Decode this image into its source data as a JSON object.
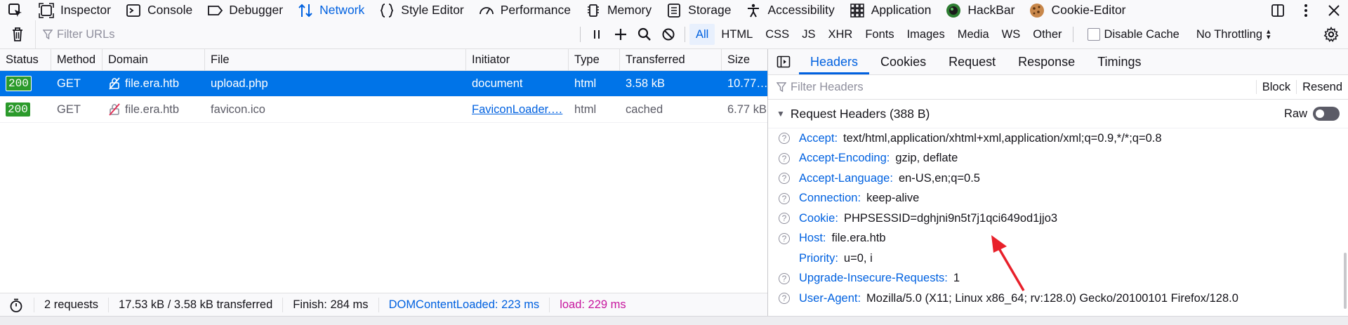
{
  "toolbox": {
    "tabs": [
      {
        "label": "Inspector",
        "icon": "inspector-icon"
      },
      {
        "label": "Console",
        "icon": "console-icon"
      },
      {
        "label": "Debugger",
        "icon": "debugger-icon"
      },
      {
        "label": "Network",
        "icon": "network-icon",
        "selected": true
      },
      {
        "label": "Style Editor",
        "icon": "style-editor-icon"
      },
      {
        "label": "Performance",
        "icon": "performance-icon"
      },
      {
        "label": "Memory",
        "icon": "memory-icon"
      },
      {
        "label": "Storage",
        "icon": "storage-icon"
      },
      {
        "label": "Accessibility",
        "icon": "accessibility-icon"
      },
      {
        "label": "Application",
        "icon": "application-icon"
      },
      {
        "label": "HackBar",
        "icon": "hackbar-icon"
      },
      {
        "label": "Cookie-Editor",
        "icon": "cookie-icon"
      }
    ]
  },
  "network_toolbar": {
    "filter_placeholder": "Filter URLs",
    "type_filters": [
      "All",
      "HTML",
      "CSS",
      "JS",
      "XHR",
      "Fonts",
      "Images",
      "Media",
      "WS",
      "Other"
    ],
    "selected_filter": "All",
    "disable_cache_label": "Disable Cache",
    "throttling_label": "No Throttling"
  },
  "request_list": {
    "columns": [
      "Status",
      "Method",
      "Domain",
      "File",
      "Initiator",
      "Type",
      "Transferred",
      "Size"
    ],
    "rows": [
      {
        "status": "200",
        "method": "GET",
        "domain": "file.era.htb",
        "file": "upload.php",
        "initiator": "document",
        "type": "html",
        "transferred": "3.58 kB",
        "size": "10.77…",
        "selected": true
      },
      {
        "status": "200",
        "method": "GET",
        "domain": "file.era.htb",
        "file": "favicon.ico",
        "initiator": "FaviconLoader.…",
        "type": "html",
        "transferred": "cached",
        "size": "6.77 kB",
        "selected": false
      }
    ]
  },
  "summary": {
    "requests": "2 requests",
    "transferred": "17.53 kB / 3.58 kB transferred",
    "finish": "Finish: 284 ms",
    "dom_content_loaded": "DOMContentLoaded: 223 ms",
    "load": "load: 229 ms"
  },
  "details": {
    "tabs": [
      "Headers",
      "Cookies",
      "Request",
      "Response",
      "Timings"
    ],
    "selected_tab": "Headers",
    "filter_placeholder": "Filter Headers",
    "block_label": "Block",
    "resend_label": "Resend",
    "section_title": "Request Headers (388 B)",
    "raw_label": "Raw",
    "headers": [
      {
        "name": "Accept:",
        "value": "text/html,application/xhtml+xml,application/xml;q=0.9,*/*;q=0.8",
        "help": true
      },
      {
        "name": "Accept-Encoding:",
        "value": "gzip, deflate",
        "help": true
      },
      {
        "name": "Accept-Language:",
        "value": "en-US,en;q=0.5",
        "help": true
      },
      {
        "name": "Connection:",
        "value": "keep-alive",
        "help": true
      },
      {
        "name": "Cookie:",
        "value": "PHPSESSID=dghjni9n5t7j1qci649od1jjo3",
        "help": true
      },
      {
        "name": "Host:",
        "value": "file.era.htb",
        "help": true
      },
      {
        "name": "Priority:",
        "value": "u=0, i",
        "help": false
      },
      {
        "name": "Upgrade-Insecure-Requests:",
        "value": "1",
        "help": true
      },
      {
        "name": "User-Agent:",
        "value": "Mozilla/5.0 (X11; Linux x86_64; rv:128.0) Gecko/20100101 Firefox/128.0",
        "help": true
      }
    ]
  },
  "colors": {
    "accent": "#0061e0",
    "status_ok": "#2b9a2b",
    "annotation_arrow": "#e8202a",
    "load": "#c7169e"
  }
}
